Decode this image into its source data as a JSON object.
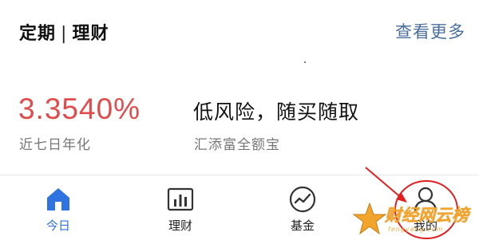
{
  "header": {
    "title_left": "定期",
    "title_sep": "|",
    "title_right": "理财",
    "more_link": "查看更多"
  },
  "product": {
    "rate": "3.3540%",
    "rate_label": "近七日年化",
    "slogan": "低风险，随买随取",
    "name": "汇添富全额宝"
  },
  "tabbar": {
    "items": [
      {
        "label": "今日",
        "icon": "home-icon",
        "active": true
      },
      {
        "label": "理财",
        "icon": "chart-bars-icon",
        "active": false
      },
      {
        "label": "基金",
        "icon": "trend-line-icon",
        "active": false
      },
      {
        "label": "我的",
        "icon": "user-icon",
        "active": false
      }
    ]
  },
  "watermark": {
    "text": "财经网云榜",
    "sub": "fengyang.com"
  },
  "colors": {
    "accent": "#2f73e0",
    "rate": "#e04c4c",
    "link": "#4a6e9c",
    "annotation": "#e02020",
    "watermark": "#f2a52a"
  }
}
